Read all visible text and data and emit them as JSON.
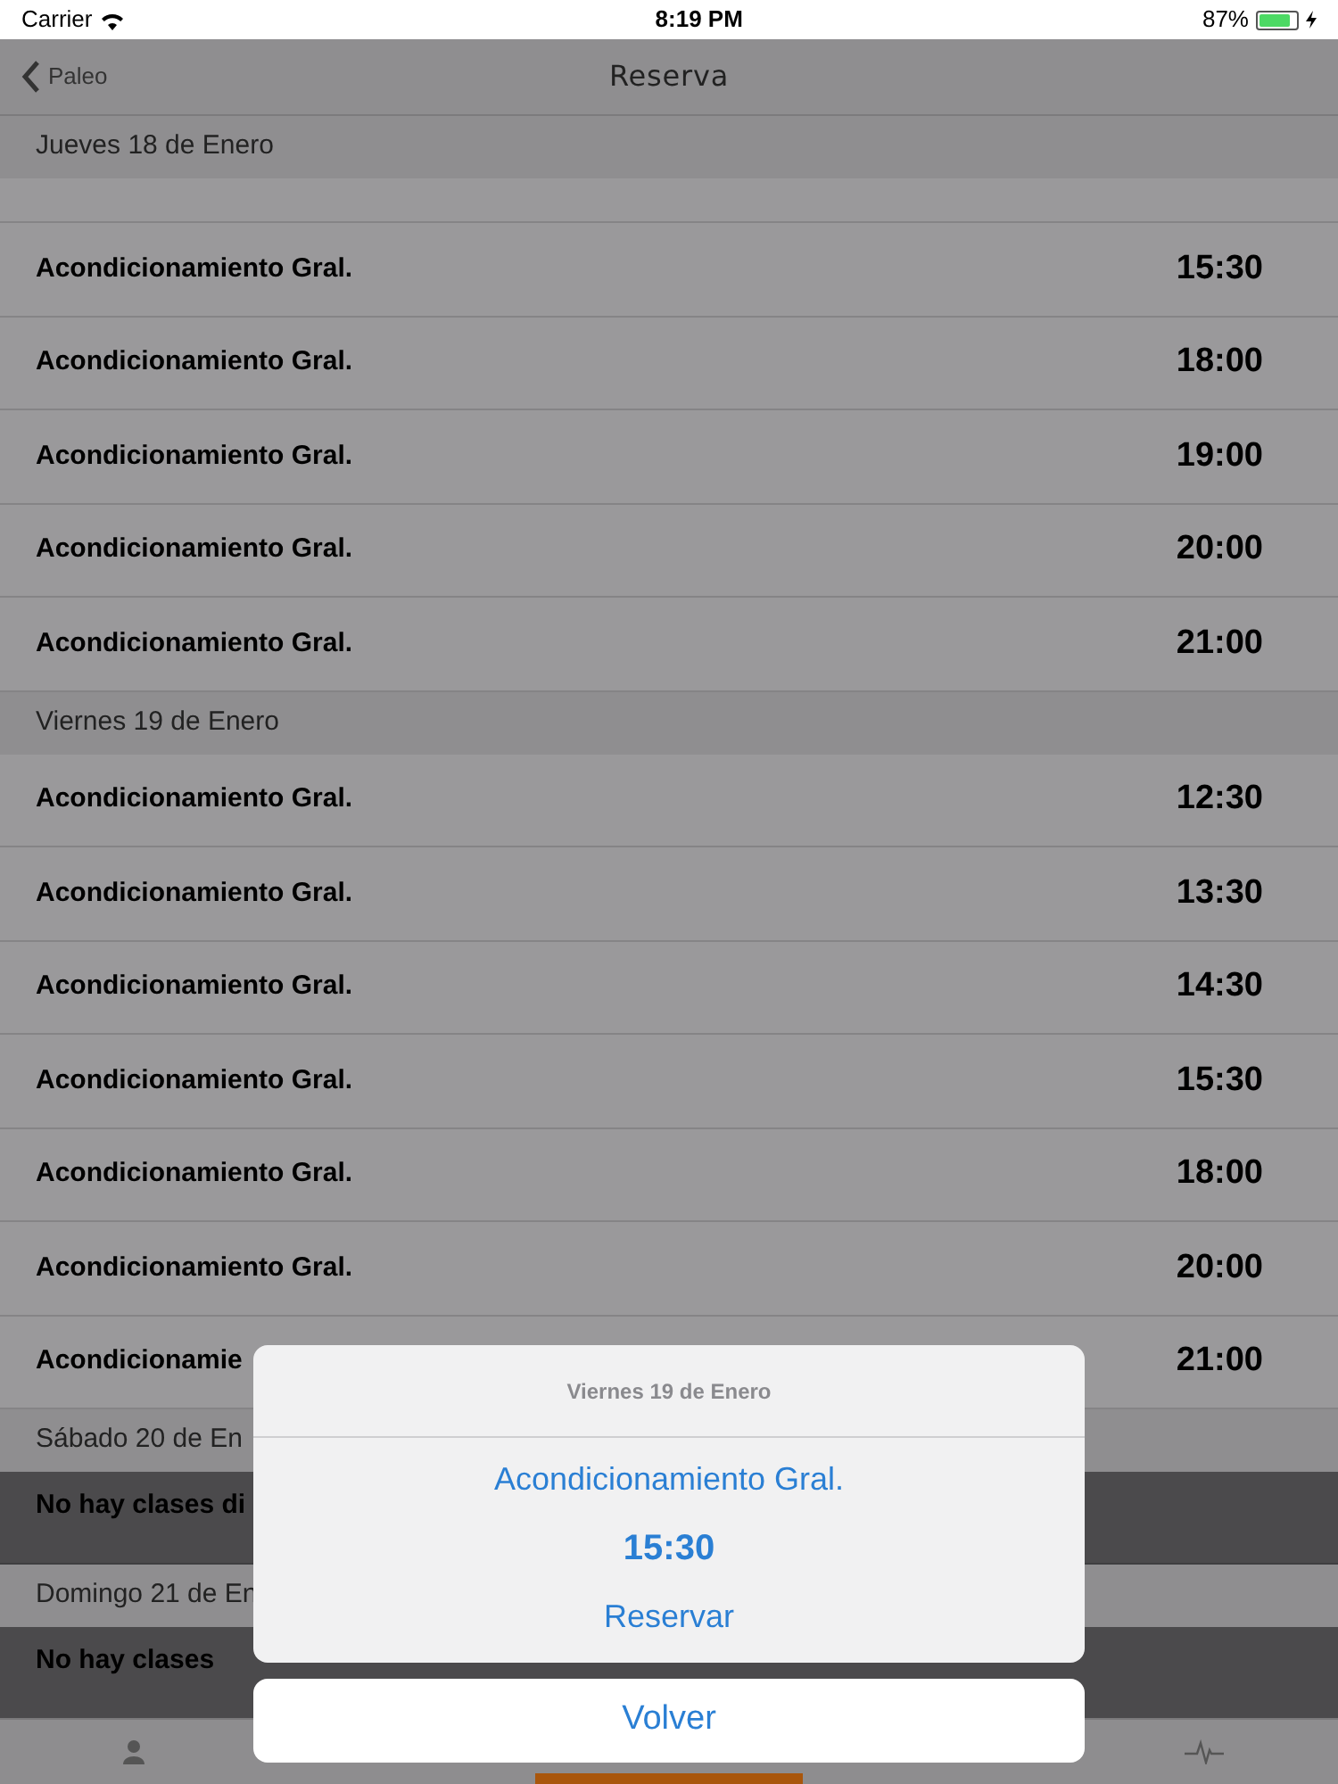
{
  "status_bar": {
    "carrier": "Carrier",
    "time": "8:19 PM",
    "battery": "87%"
  },
  "nav": {
    "back": "Paleo",
    "title": "Reserva"
  },
  "sections": [
    {
      "header": "Jueves 18 de Enero",
      "rows": [
        {
          "kind": "class",
          "name": "Acondicionamiento Gral.",
          "time": "15:30"
        },
        {
          "kind": "class",
          "name": "Acondicionamiento Gral.",
          "time": "18:00"
        },
        {
          "kind": "class",
          "name": "Acondicionamiento Gral.",
          "time": "19:00"
        },
        {
          "kind": "class",
          "name": "Acondicionamiento Gral.",
          "time": "20:00"
        },
        {
          "kind": "class",
          "name": "Acondicionamiento Gral.",
          "time": "21:00"
        }
      ]
    },
    {
      "header": "Viernes 19 de Enero",
      "rows": [
        {
          "kind": "class",
          "name": "Acondicionamiento Gral.",
          "time": "12:30"
        },
        {
          "kind": "class",
          "name": "Acondicionamiento Gral.",
          "time": "13:30"
        },
        {
          "kind": "class",
          "name": "Acondicionamiento Gral.",
          "time": "14:30"
        },
        {
          "kind": "class",
          "name": "Acondicionamiento Gral.",
          "time": "15:30"
        },
        {
          "kind": "class",
          "name": "Acondicionamiento Gral.",
          "time": "18:00"
        },
        {
          "kind": "class",
          "name": "Acondicionamiento Gral.",
          "time": "20:00"
        },
        {
          "kind": "class",
          "name": "Acondicionamie",
          "time": "21:00"
        }
      ]
    },
    {
      "header": "Sábado 20 de En",
      "rows": [
        {
          "kind": "empty",
          "name": "No hay clases di"
        }
      ]
    },
    {
      "header": "Domingo 21 de En",
      "rows": [
        {
          "kind": "empty",
          "name": "No hay clases"
        }
      ]
    }
  ],
  "tabs": [
    {
      "kind": "person",
      "selected": false
    },
    {
      "kind": "blank",
      "selected": true
    },
    {
      "kind": "pulse",
      "selected": false
    }
  ],
  "sheet": {
    "title": "Viernes 19 de Enero",
    "class": "Acondicionamiento Gral.",
    "time": "15:30",
    "action": "Reservar",
    "cancel": "Volver"
  }
}
